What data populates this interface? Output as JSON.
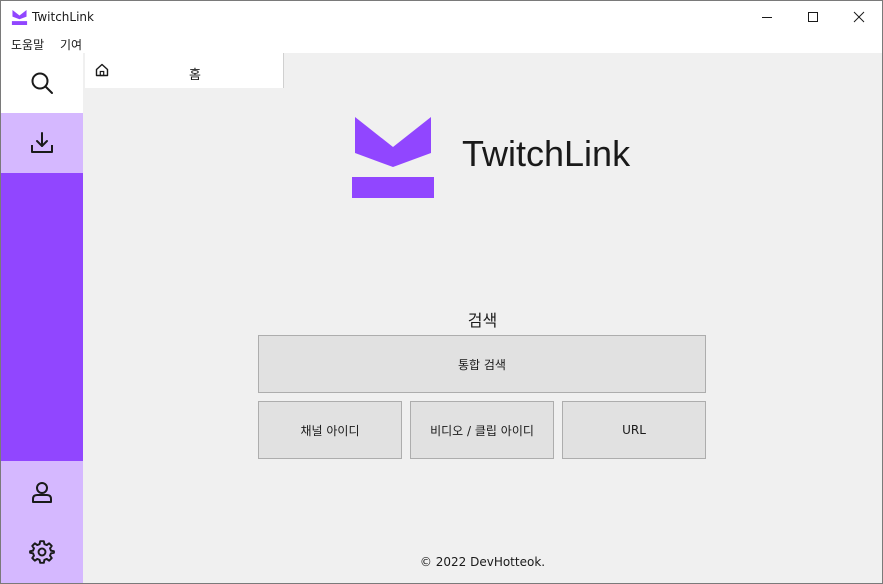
{
  "window": {
    "title": "TwitchLink",
    "brand_color": "#9146ff",
    "brand_light": "#d5b8ff",
    "controls": [
      "minimize-icon",
      "maximize-icon",
      "close-icon"
    ]
  },
  "menubar": {
    "items": [
      "도움말",
      "기여"
    ]
  },
  "sidebar": {
    "items": [
      {
        "icon": "search-icon",
        "state": "selected"
      },
      {
        "icon": "download-icon",
        "state": "normal"
      },
      {
        "icon": "account-icon",
        "state": "normal"
      },
      {
        "icon": "settings-icon",
        "state": "normal"
      }
    ]
  },
  "tabs": [
    {
      "icon": "home-icon",
      "label": "홈"
    }
  ],
  "home": {
    "brand": "TwitchLink",
    "search_heading": "검색",
    "buttons": {
      "all": "통합 검색",
      "channel": "채널 아이디",
      "video": "비디오 / 클립 아이디",
      "url": "URL"
    },
    "footer": "© 2022 DevHotteok."
  }
}
